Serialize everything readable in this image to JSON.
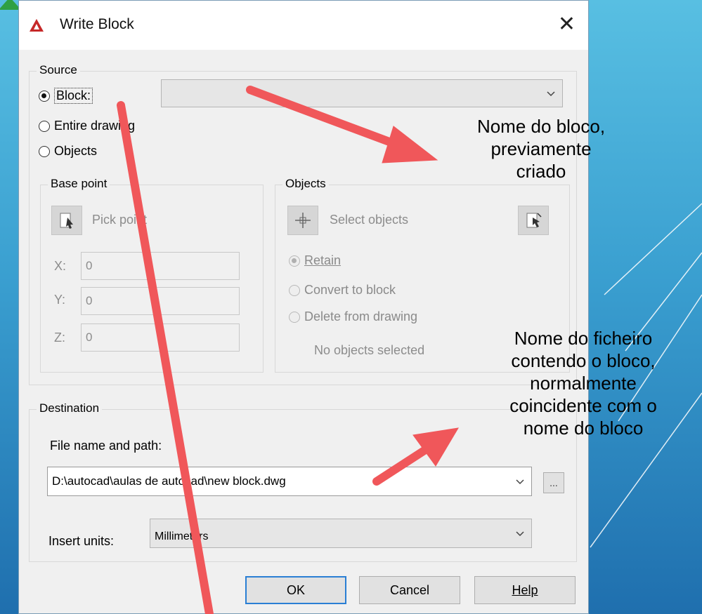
{
  "dialog": {
    "title": "Write Block",
    "close_glyph": "✕"
  },
  "source": {
    "legend": "Source",
    "options": [
      {
        "label": "Block:",
        "selected": true
      },
      {
        "label": "Entire drawing",
        "selected": false
      },
      {
        "label": "Objects",
        "selected": false
      }
    ],
    "block_combo_value": ""
  },
  "base_point": {
    "legend": "Base point",
    "pick_label": "Pick point",
    "x_label": "X:",
    "x_value": "0",
    "y_label": "Y:",
    "y_value": "0",
    "z_label": "Z:",
    "z_value": "0"
  },
  "objects": {
    "legend": "Objects",
    "select_label": "Select objects",
    "options": [
      {
        "label": "Retain",
        "selected": true
      },
      {
        "label": "Convert to block",
        "selected": false
      },
      {
        "label": "Delete from drawing",
        "selected": false
      }
    ],
    "status": "No objects selected"
  },
  "destination": {
    "legend": "Destination",
    "file_label": "File name and path:",
    "file_value": "D:\\autocad\\aulas de autocad\\new block.dwg",
    "browse_label": "...",
    "units_label": "Insert units:",
    "units_value": "Millimeters"
  },
  "buttons": {
    "ok": "OK",
    "cancel": "Cancel",
    "help": "Help"
  },
  "annotations": {
    "block_note": [
      "Nome do bloco,",
      "previamente",
      "criado"
    ],
    "file_note": [
      "Nome do ficheiro",
      "contendo o bloco,",
      "normalmente",
      "coincidente com o",
      "nome do bloco"
    ]
  },
  "colors": {
    "arrow": "#f0575a",
    "accent": "#2a7fd4",
    "background_top": "#58bfe2",
    "background_bottom": "#1f6fae"
  }
}
